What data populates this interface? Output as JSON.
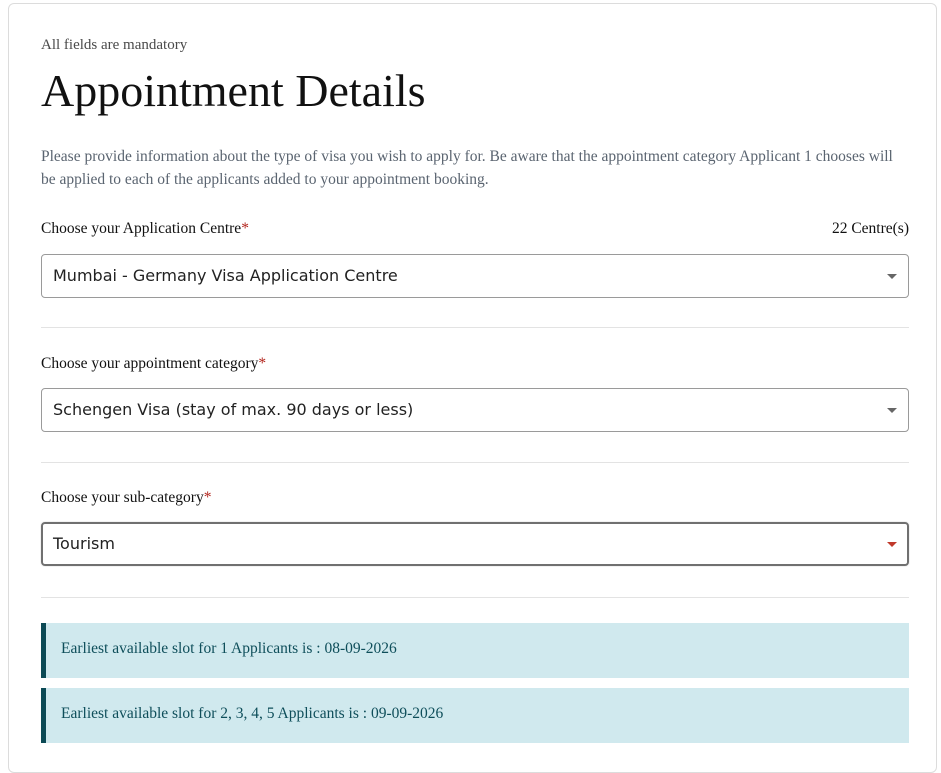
{
  "form": {
    "mandatory_note": "All fields are mandatory",
    "title": "Appointment Details",
    "description": "Please provide information about the type of visa you wish to apply for. Be aware that the appointment category Applicant 1 chooses will be applied to each of the applicants added to your appointment booking."
  },
  "centre": {
    "label": "Choose your Application Centre",
    "required_mark": "*",
    "count": "22 Centre(s)",
    "value": "Mumbai - Germany Visa Application Centre"
  },
  "category": {
    "label": "Choose your appointment category",
    "required_mark": "*",
    "value": "Schengen Visa (stay of max. 90 days or less)"
  },
  "subcategory": {
    "label": "Choose your sub-category",
    "required_mark": "*",
    "value": "Tourism"
  },
  "slots": [
    {
      "text": "Earliest available slot for 1 Applicants is : 08-09-2026"
    },
    {
      "text": "Earliest available slot for 2, 3, 4, 5 Applicants is : 09-09-2026"
    }
  ],
  "colors": {
    "required": "#b3261e",
    "slot_background": "#d0e9ee",
    "slot_border": "#0c4a55",
    "slot_text": "#0e4e5a",
    "focused_caret": "#c0392b"
  },
  "icons": {
    "dropdown": "chevron-down-icon"
  }
}
